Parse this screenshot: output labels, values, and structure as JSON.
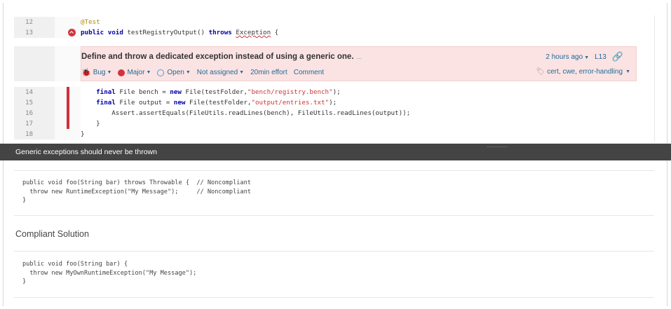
{
  "code_lines": [
    {
      "num": "12",
      "text": "@Test"
    },
    {
      "num": "13",
      "kw1": "public void",
      "mid1": " testRegistryOutput() ",
      "kw2": "throws",
      "sp": " ",
      "err": "Exception",
      "end": " {"
    },
    {
      "num": "14",
      "kw": "final",
      "a": " File bench = ",
      "kw2": "new",
      "b": " File(testFolder,",
      "str": "\"bench/registry.bench\"",
      "c": ");"
    },
    {
      "num": "15",
      "kw": "final",
      "a": " File output = ",
      "kw2": "new",
      "b": " File(testFolder,",
      "str": "\"output/entries.txt\"",
      "c": ");"
    },
    {
      "num": "16",
      "text": "        Assert.assertEquals(FileUtils.readLines(bench), FileUtils.readLines(output));"
    },
    {
      "num": "17",
      "text": "    }"
    },
    {
      "num": "18",
      "text": "}"
    }
  ],
  "issue": {
    "message": "Define and throw a dedicated exception instead of using a generic one.",
    "more": "...",
    "type": "Bug",
    "severity": "Major",
    "status": "Open",
    "assignee": "Not assigned",
    "effort": "20min effort",
    "comment": "Comment",
    "age": "2 hours ago",
    "line": "L13",
    "tags": "cert, cwe, error-handling"
  },
  "rule": {
    "title": "Generic exceptions should never be thrown",
    "noncompliant_code": "public void foo(String bar) throws Throwable {  // Noncompliant\n  throw new RuntimeException(\"My Message\");     // Noncompliant\n}",
    "compliant_title": "Compliant Solution",
    "compliant_code": "public void foo(String bar) {\n  throw new MyOwnRuntimeException(\"My Message\");\n}"
  }
}
